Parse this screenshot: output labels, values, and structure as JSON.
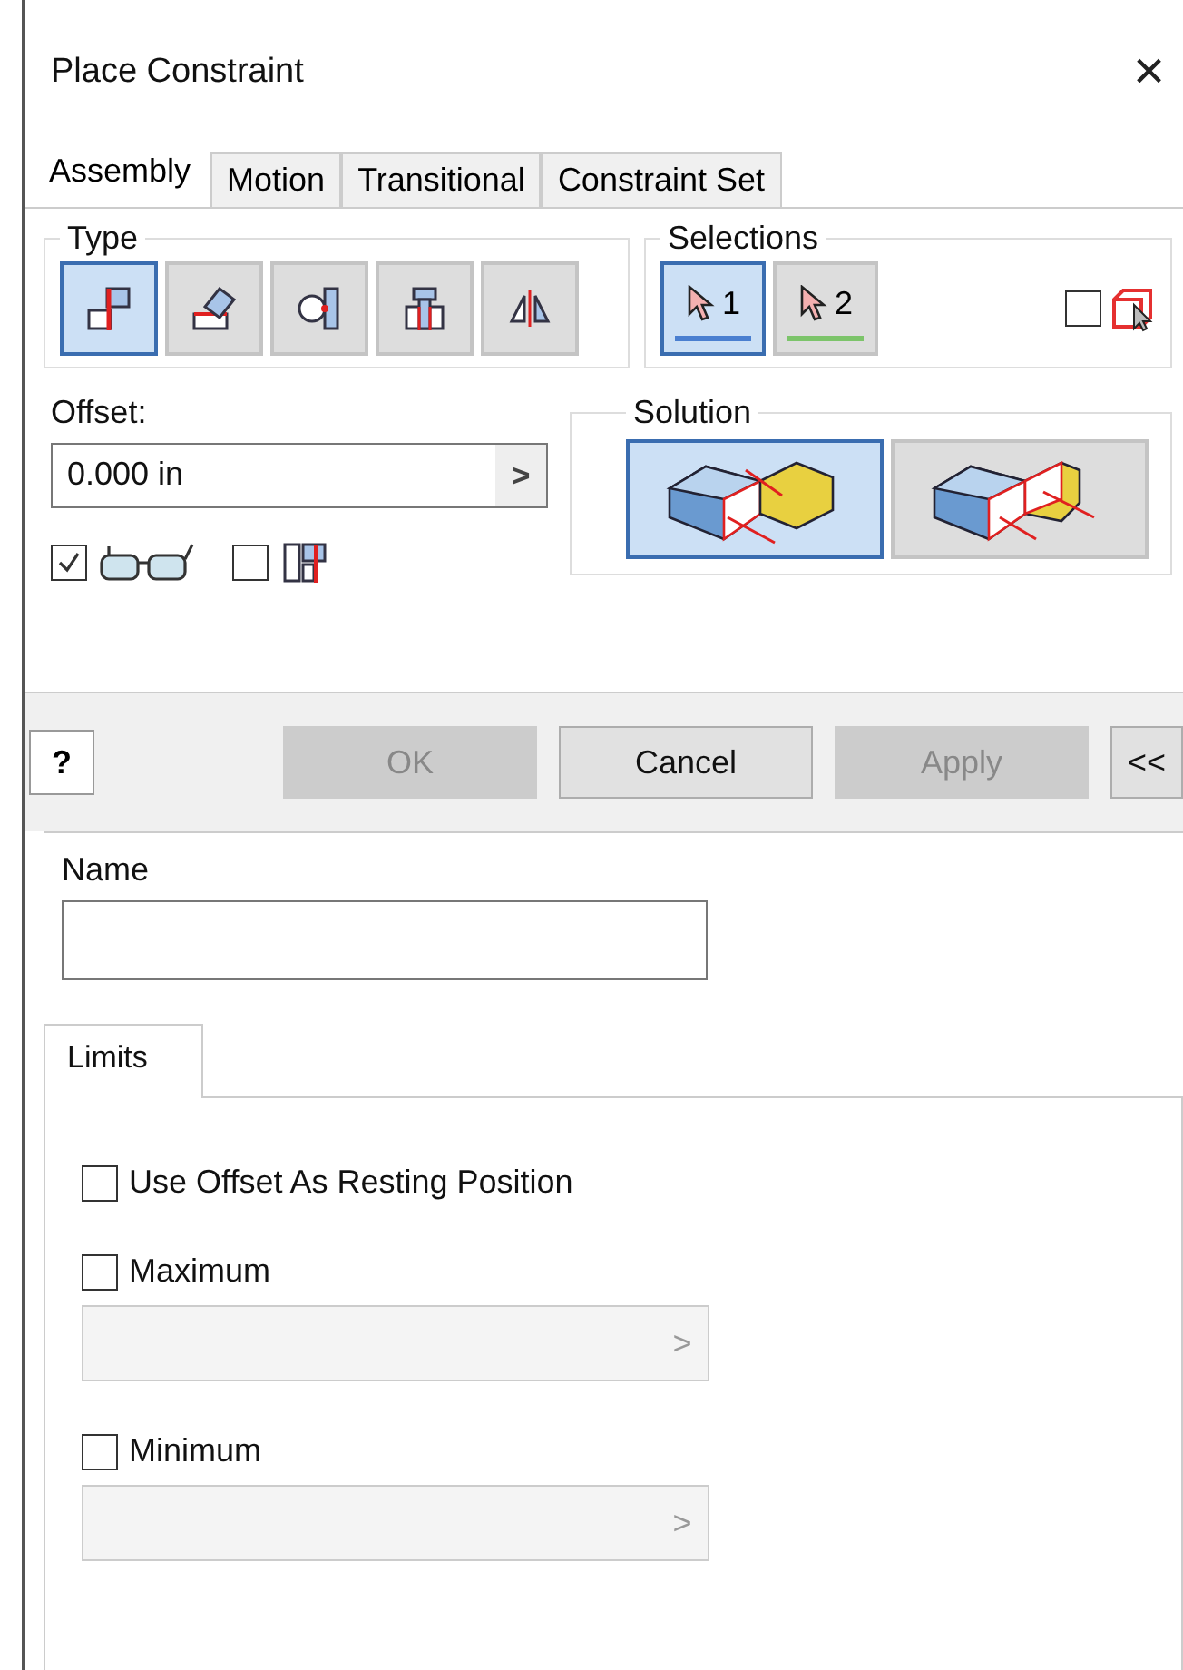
{
  "window": {
    "title": "Place Constraint",
    "close": "×"
  },
  "tabs": [
    {
      "label": "Assembly",
      "selected": true
    },
    {
      "label": "Motion",
      "selected": false
    },
    {
      "label": "Transitional",
      "selected": false
    },
    {
      "label": "Constraint Set",
      "selected": false
    }
  ],
  "type": {
    "label": "Type",
    "buttons": [
      {
        "kind": "mate",
        "selected": true
      },
      {
        "kind": "angle",
        "selected": false
      },
      {
        "kind": "tangent",
        "selected": false
      },
      {
        "kind": "insert",
        "selected": false
      },
      {
        "kind": "symmetry",
        "selected": false
      }
    ]
  },
  "selections": {
    "label": "Selections",
    "buttons": [
      {
        "label": "1",
        "selected": true,
        "color": "#4a7fd0"
      },
      {
        "label": "2",
        "selected": false,
        "color": "#7cc46a"
      }
    ],
    "first_occurrence_checked": false
  },
  "offset": {
    "label": "Offset:",
    "value": "0.000 in",
    "arrow": ">"
  },
  "options": [
    {
      "kind": "preview",
      "checked": true
    },
    {
      "kind": "predict",
      "checked": false
    }
  ],
  "solution": {
    "label": "Solution",
    "options": [
      {
        "kind": "mate",
        "selected": true
      },
      {
        "kind": "flush",
        "selected": false
      }
    ]
  },
  "help": {
    "label": "?"
  },
  "buttons": [
    {
      "label": "OK",
      "disabled": true
    },
    {
      "label": "Cancel",
      "disabled": false
    },
    {
      "label": "Apply",
      "disabled": true
    },
    {
      "label": "<<",
      "disabled": false
    }
  ],
  "name": {
    "label": "Name"
  },
  "limits": {
    "tab": "Limits",
    "items": [
      {
        "kind": "check",
        "label": "Use Offset As Resting Position",
        "checked": false
      },
      {
        "kind": "field",
        "label": "Maximum",
        "checked": false,
        "arrow": ">"
      },
      {
        "kind": "field",
        "label": "Minimum",
        "checked": false,
        "arrow": ">"
      }
    ]
  }
}
